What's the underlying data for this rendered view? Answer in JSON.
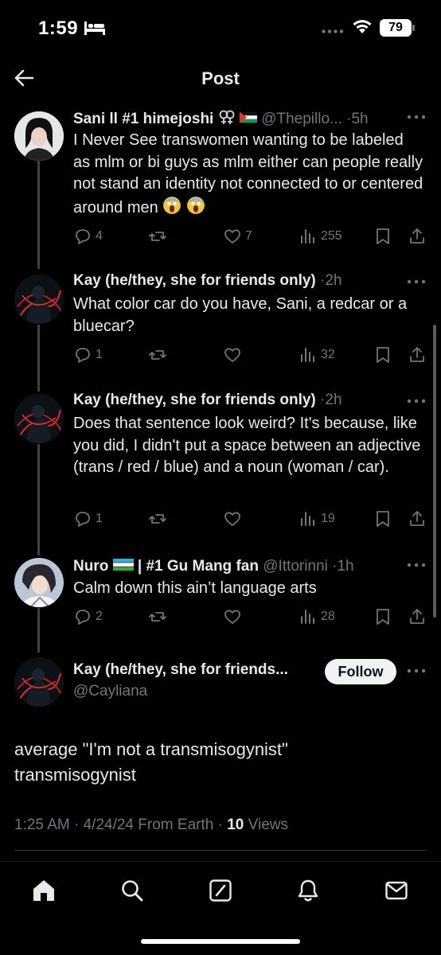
{
  "status_bar": {
    "time": "1:59",
    "battery": "79",
    "icons": [
      "sleep-focus-icon",
      "cellular-dots-icon",
      "wifi-icon",
      "battery-icon"
    ]
  },
  "header": {
    "title": "Post",
    "back_icon": "arrow-left-icon"
  },
  "replies": [
    {
      "name": "Sani ll #1 himejoshi",
      "handle": "@Thepillo...",
      "time": "5h",
      "text": "I Never See transwomen wanting to be labeled as mlm or bi guys as mlm either can people really not stand an identity not connected to or centered around men",
      "stats": {
        "replies": "4",
        "reposts": "",
        "likes": "7",
        "views": "255"
      }
    },
    {
      "name": "Kay (he/they, she for friends only)",
      "time": "2h",
      "text": "What color car do you have, Sani, a redcar or a bluecar?",
      "stats": {
        "replies": "1",
        "reposts": "",
        "likes": "",
        "views": "32"
      }
    },
    {
      "name": "Kay (he/they, she for friends only)",
      "time": "2h",
      "text": "Does that sentence look weird? It's because, like you did, I didn't put a space between an adjective (trans / red / blue) and a noun (woman / car).",
      "stats": {
        "replies": "1",
        "reposts": "",
        "likes": "",
        "views": "19"
      }
    },
    {
      "name": "Nuro",
      "name_suffix": "| #1 Gu Mang fan",
      "handle": "@Ittorinni",
      "time": "1h",
      "text": "Calm down this ain’t language arts",
      "stats": {
        "replies": "2",
        "reposts": "",
        "likes": "",
        "views": "28"
      }
    }
  ],
  "main_post": {
    "name": "Kay (he/they, she for friends...",
    "handle": "@Cayliana",
    "follow_label": "Follow",
    "text": "average \"I'm not a transmisogynist\" transmisogynist",
    "time": "1:25 AM",
    "date": "4/24/24",
    "source": "From Earth",
    "views_count": "10",
    "views_label": "Views"
  },
  "bottom_nav": [
    "home-icon",
    "search-icon",
    "grok-icon",
    "notifications-icon",
    "messages-icon"
  ],
  "colors": {
    "background": "#000000",
    "text": "#e7e9ea",
    "muted": "#71767b",
    "divider": "#2f3336",
    "thread": "#3e4144"
  }
}
